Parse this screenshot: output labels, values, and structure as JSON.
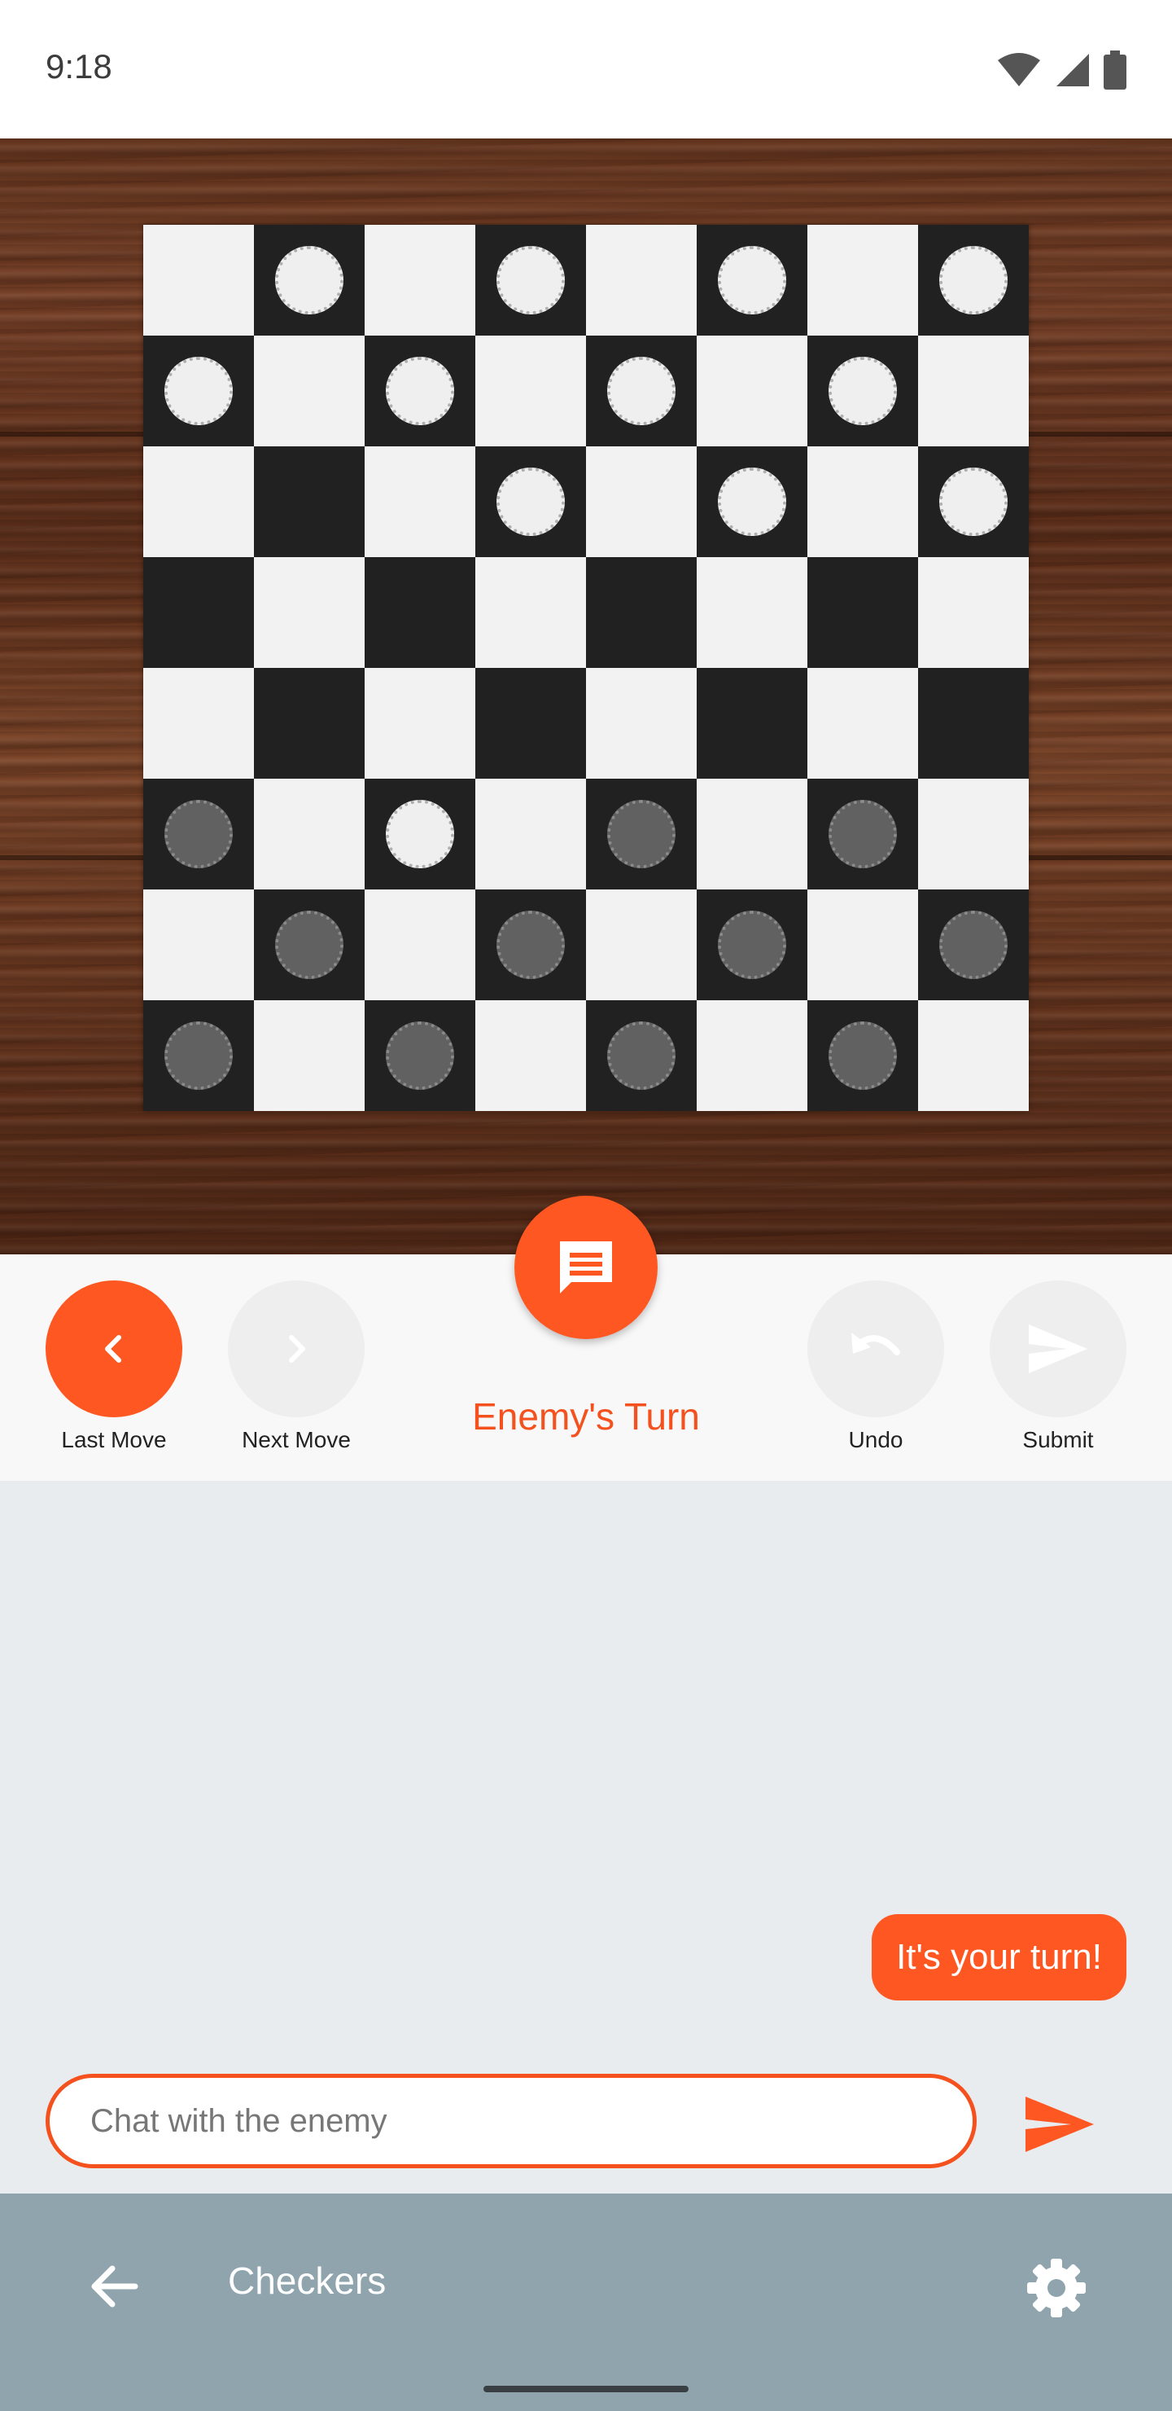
{
  "status_bar": {
    "time": "9:18",
    "icons": [
      "wifi-icon",
      "signal-icon",
      "battery-icon"
    ]
  },
  "board": {
    "rows": [
      [
        "",
        "w",
        "",
        "w",
        "",
        "w",
        "",
        "w"
      ],
      [
        "w",
        "",
        "w",
        "",
        "w",
        "",
        "w",
        ""
      ],
      [
        "",
        "",
        "",
        "w",
        "",
        "w",
        "",
        "w"
      ],
      [
        "",
        "",
        "",
        "",
        "",
        "",
        "",
        ""
      ],
      [
        "",
        "",
        "",
        "",
        "",
        "",
        "",
        ""
      ],
      [
        "b",
        "",
        "w",
        "",
        "b",
        "",
        "b",
        ""
      ],
      [
        "",
        "b",
        "",
        "b",
        "",
        "b",
        "",
        "b"
      ],
      [
        "b",
        "",
        "b",
        "",
        "b",
        "",
        "b",
        ""
      ]
    ],
    "colors": {
      "light": "#F2F2F2",
      "dark": "#212121",
      "white_piece": "#EFEFEF",
      "black_piece": "#616161"
    }
  },
  "controls": {
    "last_move": "Last Move",
    "next_move": "Next Move",
    "turn_status": "Enemy's Turn",
    "undo": "Undo",
    "submit": "Submit",
    "accent": "#FF5722"
  },
  "chat": {
    "messages": [
      {
        "text": "It's your turn!"
      }
    ],
    "placeholder": "Chat with the enemy"
  },
  "app_bar": {
    "title": "Checkers",
    "background": "#90A4AE"
  }
}
